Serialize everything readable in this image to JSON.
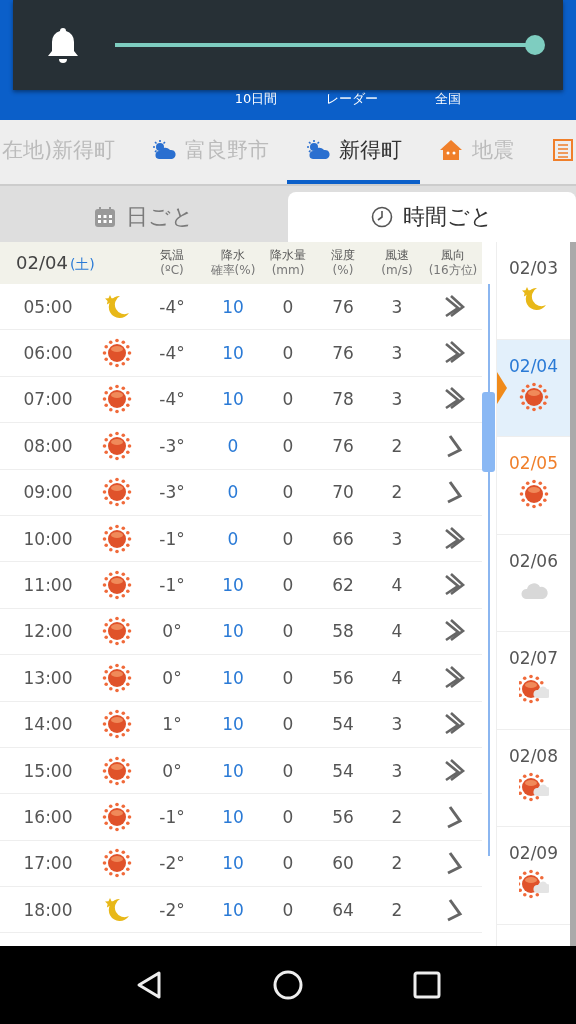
{
  "volume_overlay": {
    "level": 1.0
  },
  "header": {
    "nav_labels": [
      "10日間",
      "レーダー",
      "全国"
    ]
  },
  "location_tabs": [
    {
      "label": "在地)新得町",
      "kind": "plain",
      "selected": false
    },
    {
      "label": "富良野市",
      "kind": "weather",
      "selected": false
    },
    {
      "label": "新得町",
      "kind": "weather",
      "selected": true
    },
    {
      "label": "地震",
      "kind": "house",
      "selected": false
    },
    {
      "kind": "list",
      "selected": false
    }
  ],
  "view_tabs": [
    {
      "label": "日ごと",
      "kind": "calendar",
      "selected": false
    },
    {
      "label": "時間ごと",
      "kind": "clock",
      "selected": true
    }
  ],
  "table": {
    "date": "02/04",
    "weekday": "(土)",
    "columns": [
      {
        "name": "気温",
        "unit": "(ºC)"
      },
      {
        "name": "降水",
        "unit": "確率(%)"
      },
      {
        "name": "降水量",
        "unit": "(mm)"
      },
      {
        "name": "湿度",
        "unit": "(%)"
      },
      {
        "name": "風速",
        "unit": "(m/s)"
      },
      {
        "name": "風向",
        "unit": "(16方位)"
      }
    ],
    "rows": [
      {
        "time": "05:00",
        "kind": "moon-double",
        "temp": "-4°",
        "precip_prob": "10",
        "precip_mm": "0",
        "humidity": "76",
        "wind_speed": "3"
      },
      {
        "time": "06:00",
        "kind": "sun-double",
        "temp": "-4°",
        "precip_prob": "10",
        "precip_mm": "0",
        "humidity": "76",
        "wind_speed": "3"
      },
      {
        "time": "07:00",
        "kind": "sun-double",
        "temp": "-4°",
        "precip_prob": "10",
        "precip_mm": "0",
        "humidity": "78",
        "wind_speed": "3"
      },
      {
        "time": "08:00",
        "kind": "sun-single",
        "temp": "-3°",
        "precip_prob": "0",
        "precip_mm": "0",
        "humidity": "76",
        "wind_speed": "2"
      },
      {
        "time": "09:00",
        "kind": "sun-single",
        "temp": "-3°",
        "precip_prob": "0",
        "precip_mm": "0",
        "humidity": "70",
        "wind_speed": "2"
      },
      {
        "time": "10:00",
        "kind": "sun-double",
        "temp": "-1°",
        "precip_prob": "0",
        "precip_mm": "0",
        "humidity": "66",
        "wind_speed": "3"
      },
      {
        "time": "11:00",
        "kind": "sun-double",
        "temp": "-1°",
        "precip_prob": "10",
        "precip_mm": "0",
        "humidity": "62",
        "wind_speed": "4"
      },
      {
        "time": "12:00",
        "kind": "sun-double",
        "temp": "0°",
        "precip_prob": "10",
        "precip_mm": "0",
        "humidity": "58",
        "wind_speed": "4"
      },
      {
        "time": "13:00",
        "kind": "sun-double",
        "temp": "0°",
        "precip_prob": "10",
        "precip_mm": "0",
        "humidity": "56",
        "wind_speed": "4"
      },
      {
        "time": "14:00",
        "kind": "sun-double",
        "temp": "1°",
        "precip_prob": "10",
        "precip_mm": "0",
        "humidity": "54",
        "wind_speed": "3"
      },
      {
        "time": "15:00",
        "kind": "sun-double",
        "temp": "0°",
        "precip_prob": "10",
        "precip_mm": "0",
        "humidity": "54",
        "wind_speed": "3"
      },
      {
        "time": "16:00",
        "kind": "sun-single",
        "temp": "-1°",
        "precip_prob": "10",
        "precip_mm": "0",
        "humidity": "56",
        "wind_speed": "2"
      },
      {
        "time": "17:00",
        "kind": "sun-single",
        "temp": "-2°",
        "precip_prob": "10",
        "precip_mm": "0",
        "humidity": "60",
        "wind_speed": "2"
      },
      {
        "time": "18:00",
        "kind": "moon-single",
        "temp": "-2°",
        "precip_prob": "10",
        "precip_mm": "0",
        "humidity": "64",
        "wind_speed": "2"
      }
    ]
  },
  "day_list": [
    {
      "date": "02/03",
      "kind": "moon",
      "color": "#555555",
      "selected": false
    },
    {
      "date": "02/04",
      "kind": "sun",
      "color": "#2a7ad6",
      "selected": true
    },
    {
      "date": "02/05",
      "kind": "sun",
      "color": "#f07f2a",
      "selected": false
    },
    {
      "date": "02/06",
      "kind": "cloud",
      "color": "#555555",
      "selected": false
    },
    {
      "date": "02/07",
      "kind": "sun_cloud",
      "color": "#555555",
      "selected": false
    },
    {
      "date": "02/08",
      "kind": "sun_cloud",
      "color": "#555555",
      "selected": false
    },
    {
      "date": "02/09",
      "kind": "sun_cloud",
      "color": "#555555",
      "selected": false
    }
  ]
}
